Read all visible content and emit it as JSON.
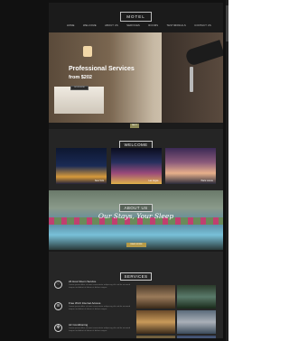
{
  "header": {
    "logo": "MOTEL",
    "nav": [
      "HOME",
      "WELCOME",
      "ABOUT US",
      "SERVICES",
      "ROOMS",
      "TESTIMONIALS",
      "CONTACT US"
    ]
  },
  "hero": {
    "title": "Professional Services",
    "subtitle": "from $202",
    "button": "BOOK NOW",
    "badge": "NEXT"
  },
  "welcome": {
    "heading": "WELCOME",
    "cards": [
      {
        "label": "New York"
      },
      {
        "label": "Las Vegas"
      },
      {
        "label": "Paris Louvre"
      }
    ]
  },
  "about": {
    "heading": "ABOUT US",
    "tagline": "Our Stays, Your Sleep",
    "button": "READ MORE"
  },
  "services": {
    "heading": "SERVICES",
    "items": [
      {
        "icon": "heart-icon",
        "title": "24 Hour Room Service",
        "text": "Lorem ipsum dolor sit amet consectetur adipiscing elit sed do eiusmod tempor incididunt ut labore et dolore magna."
      },
      {
        "icon": "wifi-icon",
        "title": "Free Wi-Fi Internet Access",
        "text": "Lorem ipsum dolor sit amet consectetur adipiscing elit sed do eiusmod tempor incididunt ut labore et dolore magna."
      },
      {
        "icon": "snowflake-icon",
        "title": "Air Conditioning",
        "text": "Lorem ipsum dolor sit amet consectetur adipiscing elit sed do eiusmod tempor incididunt ut labore et dolore magna."
      }
    ]
  },
  "colors": {
    "page_bg": "#1b1b1b",
    "accent": "#b59a48"
  }
}
